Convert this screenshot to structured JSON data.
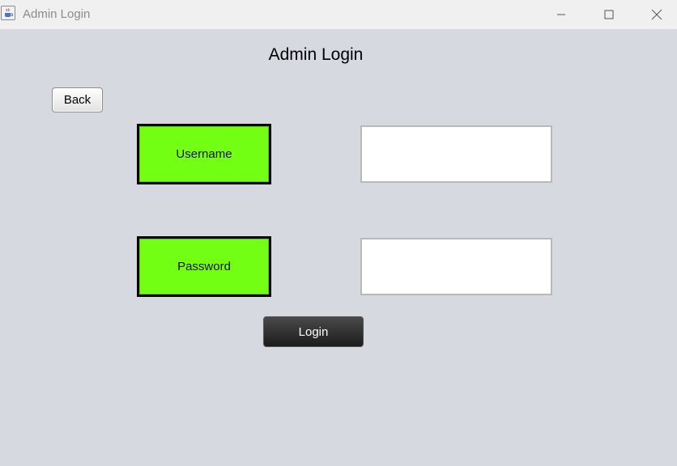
{
  "window": {
    "title": "Admin Login",
    "app_icon": "java-coffee-cup-icon",
    "controls": {
      "minimize_icon": "minimize-icon",
      "maximize_icon": "maximize-icon",
      "close_icon": "close-icon"
    }
  },
  "form": {
    "heading": "Admin Login",
    "back_label": "Back",
    "username_label": "Username",
    "username_value": "",
    "password_label": "Password",
    "password_value": "",
    "login_label": "Login"
  },
  "colors": {
    "background": "#d6d9e0",
    "label_fill": "#73ff14",
    "login_button": "#2a2a2a"
  }
}
